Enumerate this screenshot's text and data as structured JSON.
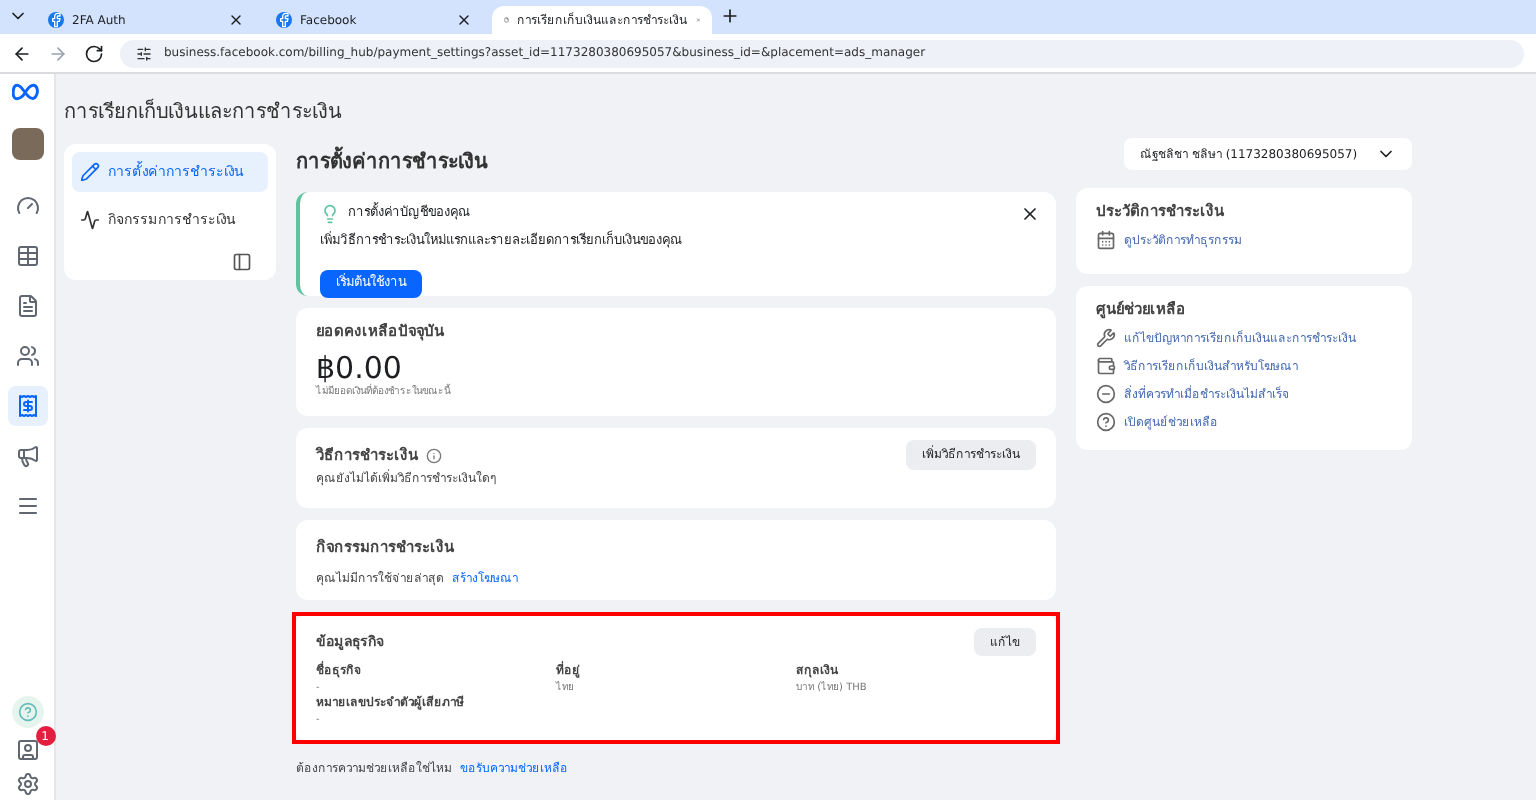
{
  "browser": {
    "tabs": [
      {
        "title": "2FA Auth",
        "kind": "facebook",
        "selected": false
      },
      {
        "title": "Facebook",
        "kind": "facebook",
        "selected": false
      },
      {
        "title": "การเรียกเก็บเงินและการชำระเงิน",
        "kind": "page",
        "selected": true
      }
    ],
    "url": "business.facebook.com/billing_hub/payment_settings?asset_id=1173280380695057&business_id=&placement=ads_manager"
  },
  "rail": {
    "items": [
      {
        "kind": "gauge",
        "selected": false
      },
      {
        "kind": "table",
        "selected": false
      },
      {
        "kind": "document",
        "selected": false
      },
      {
        "kind": "people",
        "selected": false
      },
      {
        "kind": "billing",
        "selected": true
      },
      {
        "kind": "megaphone",
        "selected": false
      },
      {
        "kind": "menu",
        "selected": false
      }
    ],
    "notification_count": "1"
  },
  "page_title": "การเรียกเก็บเงินและการชำระเงิน",
  "sidebar": {
    "items": [
      {
        "label": "การตั้งค่าการชำระเงิน",
        "kind": "settings",
        "selected": true
      },
      {
        "label": "กิจกรรมการชำระเงิน",
        "kind": "activity",
        "selected": false
      }
    ]
  },
  "main": {
    "title": "การตั้งค่าการชำระเงิน",
    "account_select": "ณัฐชลิชา ชลิษา (1173280380695057)",
    "notice": {
      "title": "การตั้งค่าบัญชีของคุณ",
      "text": "เพิ่มวิธีการชำระเงินใหม่แรกและรายละเอียดการเรียกเก็บเงินของคุณ",
      "button": "เริ่มต้นใช้งาน"
    },
    "balance": {
      "title": "ยอดคงเหลือปัจจุบัน",
      "amount": "฿0.00",
      "note": "ไม่มียอดเงินที่ต้องชำระในขณะนี้"
    },
    "payment_methods": {
      "title": "วิธีการชำระเงิน",
      "text": "คุณยังไม่ได้เพิ่มวิธีการชำระเงินใดๆ",
      "button": "เพิ่มวิธีการชำระเงิน"
    },
    "activity": {
      "title": "กิจกรรมการชำระเงิน",
      "text": "คุณไม่มีการใช้จ่ายล่าสุด",
      "link": "สร้างโฆษณา"
    },
    "business_info": {
      "title": "ข้อมูลธุรกิจ",
      "button": "แก้ไข",
      "highlighted": true,
      "fields": [
        {
          "label": "ชื่อธุรกิจ",
          "value": "-"
        },
        {
          "label": "ที่อยู่",
          "value": "ไทย"
        },
        {
          "label": "สกุลเงิน",
          "value": "บาท (ไทย) THB"
        },
        {
          "label": "หมายเลขประจำตัวผู้เสียภาษี",
          "value": "-"
        }
      ]
    },
    "footer": {
      "text": "ต้องการความช่วยเหลือใช่ไหม",
      "link": "ขอรับความช่วยเหลือ"
    }
  },
  "right": {
    "history": {
      "title": "ประวัติการชำระเงิน",
      "link": "ดูประวัติการทำธุรกรรม"
    },
    "help": {
      "title": "ศูนย์ช่วยเหลือ",
      "links": [
        {
          "label": "แก้ไขปัญหาการเรียกเก็บเงินและการชำระเงิน",
          "kind": "tools"
        },
        {
          "label": "วิธีการเรียกเก็บเงินสำหรับโฆษณา",
          "kind": "wallet"
        },
        {
          "label": "สิ่งที่ควรทำเมื่อชำระเงินไม่สำเร็จ",
          "kind": "minus"
        },
        {
          "label": "เปิดศูนย์ช่วยเหลือ",
          "kind": "question"
        }
      ]
    }
  }
}
